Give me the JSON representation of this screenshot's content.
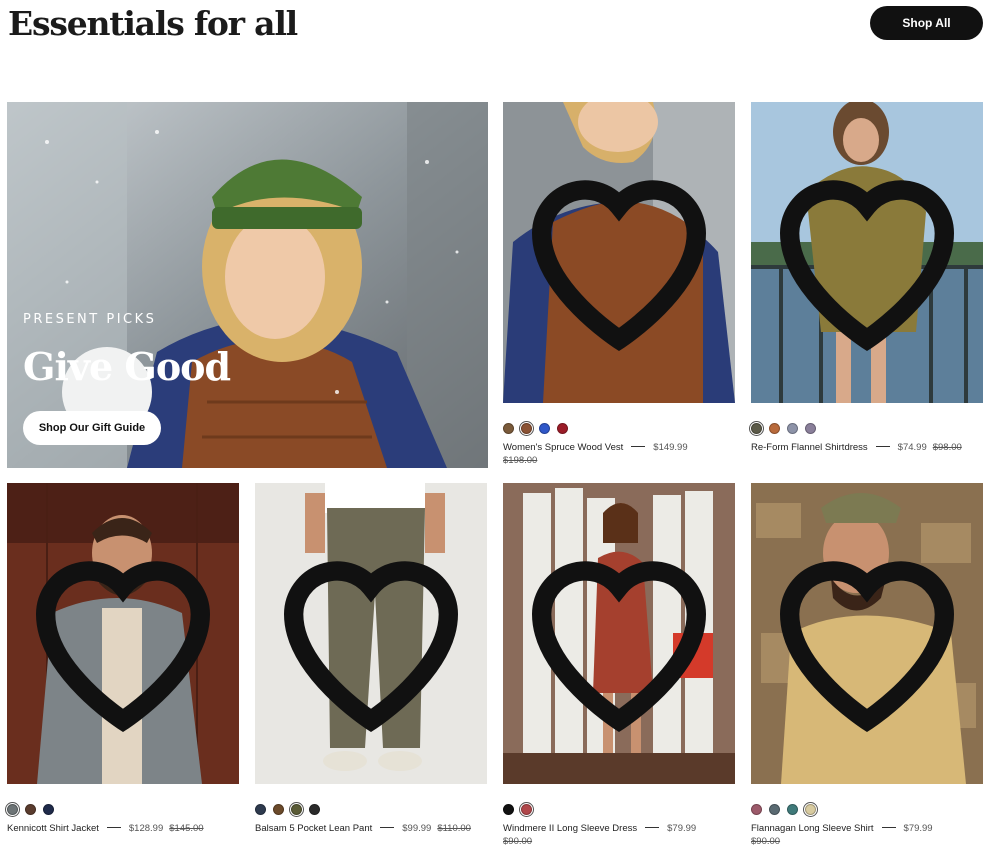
{
  "header": {
    "title": "Essentials for all",
    "shop_all_label": "Shop All"
  },
  "hero": {
    "eyebrow": "PRESENT PICKS",
    "title": "Give Good",
    "cta_label": "Shop Our Gift Guide"
  },
  "products": [
    {
      "name": "Women's Spruce Wood Vest",
      "price": "$149.99",
      "original_price": "$198.00",
      "swatches": [
        "#7a5a3a",
        "#8b5233",
        "#2f57c8",
        "#9b1c28"
      ],
      "selected_swatch": 1
    },
    {
      "name": "Re-Form Flannel Shirtdress",
      "price": "$74.99",
      "original_price": "$98.00",
      "swatches": [
        "#5b5a48",
        "#b86a3b",
        "#8d93a8",
        "#8a7f9a"
      ],
      "selected_swatch": 0
    },
    {
      "name": "Kennicott Shirt Jacket",
      "price": "$128.99",
      "original_price": "$145.00",
      "swatches": [
        "#6d7476",
        "#5a3c2e",
        "#1f2a4a"
      ],
      "selected_swatch": 0
    },
    {
      "name": "Balsam 5 Pocket Lean Pant",
      "price": "$99.99",
      "original_price": "$110.00",
      "swatches": [
        "#2e3a4e",
        "#6b4a2a",
        "#5a5b36",
        "#2a2a2a"
      ],
      "selected_swatch": 2
    },
    {
      "name": "Windmere II Long Sleeve Dress",
      "price": "$79.99",
      "original_price": "$90.00",
      "swatches": [
        "#111111",
        "#b0474a"
      ],
      "selected_swatch": 1
    },
    {
      "name": "Flannagan Long Sleeve Shirt",
      "price": "$79.99",
      "original_price": "$90.00",
      "swatches": [
        "#9c5a6a",
        "#5a6a72",
        "#3f7a7a",
        "#d8cba0"
      ],
      "selected_swatch": 3
    }
  ]
}
